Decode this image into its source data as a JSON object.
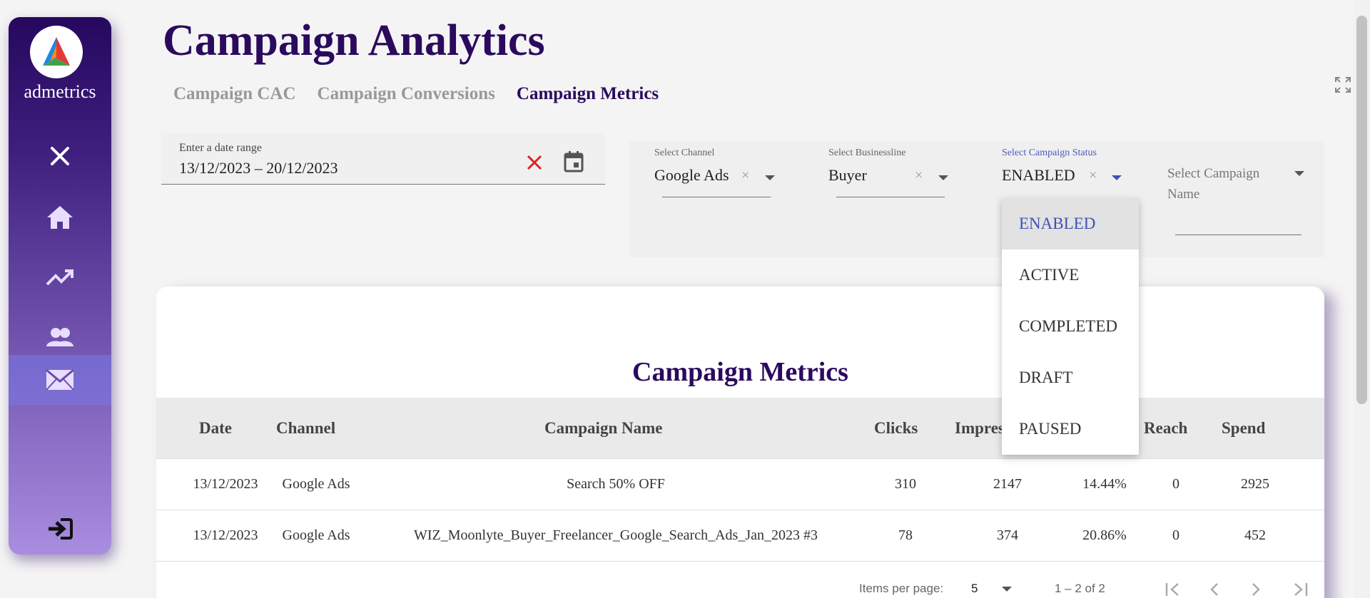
{
  "brand": {
    "name": "admetrics"
  },
  "page": {
    "title": "Campaign Analytics"
  },
  "tabs": [
    {
      "label": "Campaign CAC"
    },
    {
      "label": "Campaign Conversions"
    },
    {
      "label": "Campaign Metrics"
    }
  ],
  "date_range": {
    "label": "Enter a date range",
    "value": "13/12/2023 – 20/12/2023"
  },
  "filters": {
    "channel": {
      "label": "Select Channel",
      "value": "Google Ads"
    },
    "businessline": {
      "label": "Select Businessline",
      "value": "Buyer"
    },
    "status": {
      "label": "Select Campaign Status",
      "value": "ENABLED"
    },
    "campaign_name": {
      "placeholder_line1": "Select Campaign",
      "placeholder_line2": "Name"
    }
  },
  "status_options": [
    "ENABLED",
    "ACTIVE",
    "COMPLETED",
    "DRAFT",
    "PAUSED"
  ],
  "table": {
    "title": "Campaign Metrics",
    "headers": [
      "Date",
      "Channel",
      "Campaign Name",
      "Clicks",
      "Impres",
      "Reach",
      "Spend"
    ],
    "rows": [
      [
        "13/12/2023",
        "Google Ads",
        "Search 50% OFF",
        "310",
        "2147",
        "14.44%",
        "0",
        "2925"
      ],
      [
        "13/12/2023",
        "Google Ads",
        "WIZ_Moonlyte_Buyer_Freelancer_Google_Search_Ads_Jan_2023 #3",
        "78",
        "374",
        "20.86%",
        "0",
        "452"
      ]
    ]
  },
  "pagination": {
    "items_label": "Items per page:",
    "page_size": "5",
    "range": "1 – 2 of 2"
  },
  "colors": {
    "primary": "#2b0a5e",
    "accent": "#3f51b5",
    "clear": "#e02020"
  }
}
